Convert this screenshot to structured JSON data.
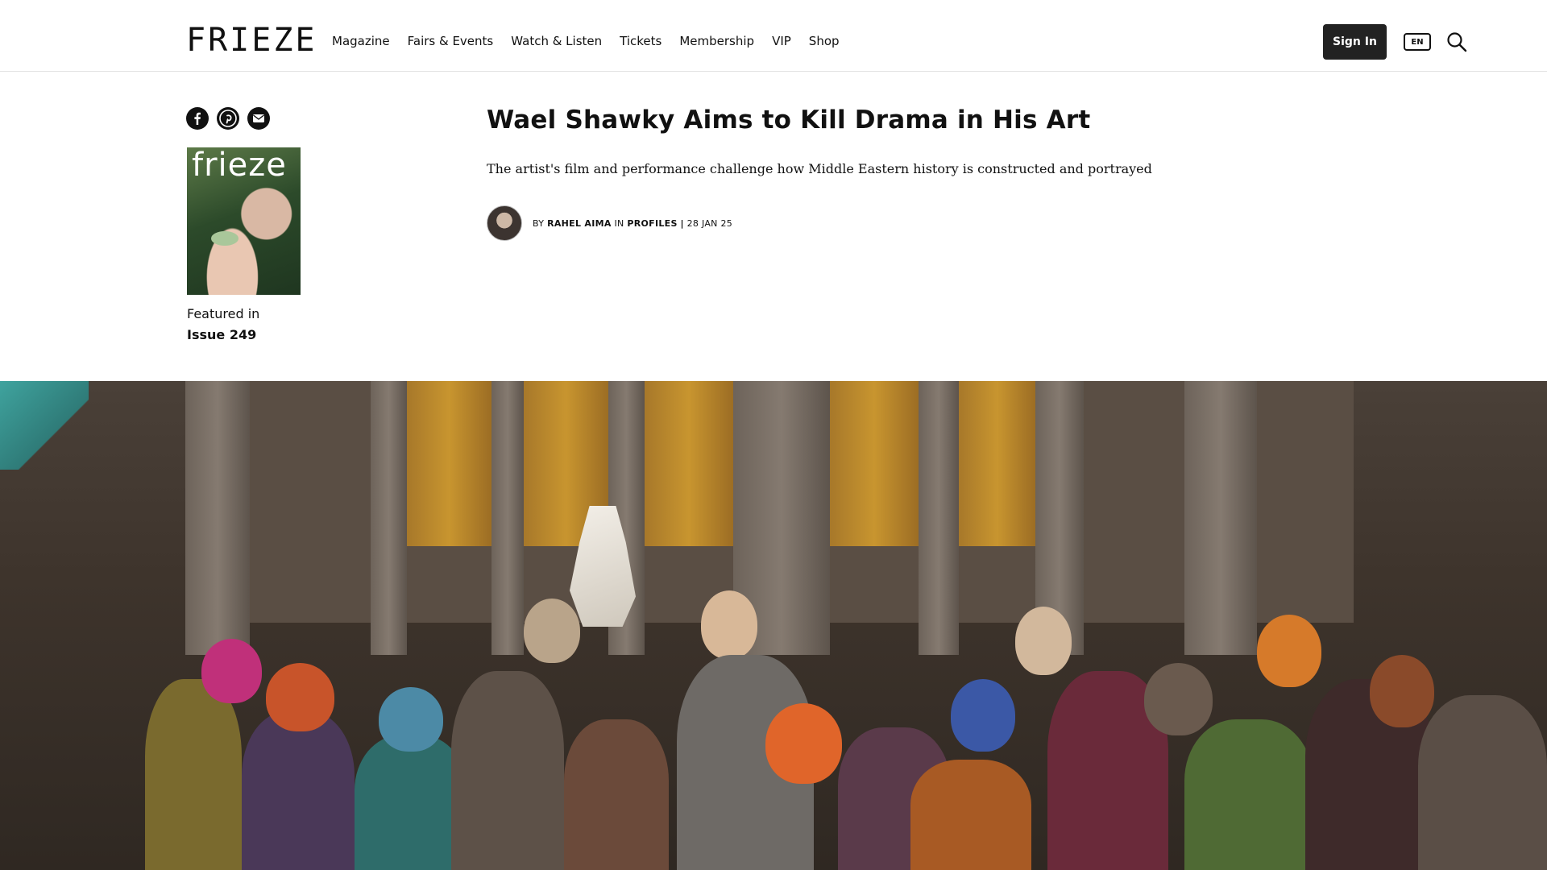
{
  "header": {
    "logo": "FRIEZE",
    "nav": [
      "Magazine",
      "Fairs & Events",
      "Watch & Listen",
      "Tickets",
      "Membership",
      "VIP",
      "Shop"
    ],
    "sign_in": "Sign In",
    "language": "EN",
    "search_icon": "search-icon"
  },
  "share": {
    "icons": [
      "facebook-icon",
      "pinterest-icon",
      "email-icon"
    ]
  },
  "issue": {
    "cover_title": "frieze",
    "featured_label": "Featured in",
    "issue_name": "Issue 249"
  },
  "article": {
    "title": "Wael Shawky Aims to Kill Drama in His Art",
    "subtitle": "The artist's film and performance challenge how Middle Eastern history is constructed and portrayed",
    "byline": {
      "by": "BY",
      "author": "RAHEL AIMA",
      "in": "IN",
      "section": "PROFILES",
      "separator": "|",
      "date": "28 JAN 25"
    }
  },
  "colors": {
    "sign_in_bg": "#222222",
    "text": "#111111",
    "divider": "#e2e2e2"
  }
}
